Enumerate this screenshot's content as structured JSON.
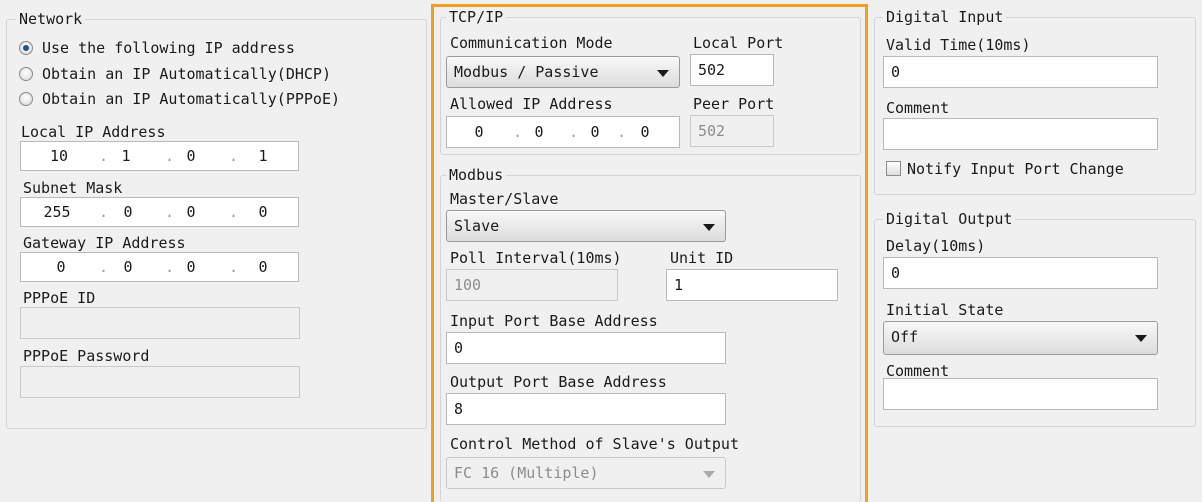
{
  "network": {
    "legend": "Network",
    "radio_static": "Use the following IP address",
    "radio_dhcp": "Obtain an IP Automatically(DHCP)",
    "radio_pppoe": "Obtain an IP Automatically(PPPoE)",
    "local_ip_label": "Local IP Address",
    "local_ip": [
      "10",
      "1",
      "0",
      "1"
    ],
    "subnet_label": "Subnet Mask",
    "subnet": [
      "255",
      "0",
      "0",
      "0"
    ],
    "gateway_label": "Gateway IP Address",
    "gateway": [
      "0",
      "0",
      "0",
      "0"
    ],
    "pppoe_id_label": "PPPoE ID",
    "pppoe_id_value": "",
    "pppoe_password_label": "PPPoE Password",
    "pppoe_password_value": ""
  },
  "tcpip": {
    "legend": "TCP/IP",
    "comm_mode_label": "Communication Mode",
    "comm_mode_value": "Modbus / Passive",
    "local_port_label": "Local Port",
    "local_port_value": "502",
    "allowed_ip_label": "Allowed IP Address",
    "allowed_ip": [
      "0",
      "0",
      "0",
      "0"
    ],
    "peer_port_label": "Peer Port",
    "peer_port_value": "502"
  },
  "modbus": {
    "legend": "Modbus",
    "master_slave_label": "Master/Slave",
    "master_slave_value": "Slave",
    "poll_interval_label": "Poll Interval(10ms)",
    "poll_interval_value": "100",
    "unit_id_label": "Unit ID",
    "unit_id_value": "1",
    "input_base_label": "Input Port Base Address",
    "input_base_value": "0",
    "output_base_label": "Output Port Base Address",
    "output_base_value": "8",
    "control_method_label": "Control Method of Slave's Output",
    "control_method_value": "FC 16 (Multiple)"
  },
  "digital_input": {
    "legend": "Digital Input",
    "valid_time_label": "Valid Time(10ms)",
    "valid_time_value": "0",
    "comment_label": "Comment",
    "comment_value": "",
    "notify_label": "Notify Input Port Change"
  },
  "digital_output": {
    "legend": "Digital Output",
    "delay_label": "Delay(10ms)",
    "delay_value": "0",
    "initial_state_label": "Initial State",
    "initial_state_value": "Off",
    "comment_label": "Comment",
    "comment_value": ""
  },
  "colors": {
    "highlight": "#f0a020",
    "radio_dot": "#1f4f9c"
  }
}
